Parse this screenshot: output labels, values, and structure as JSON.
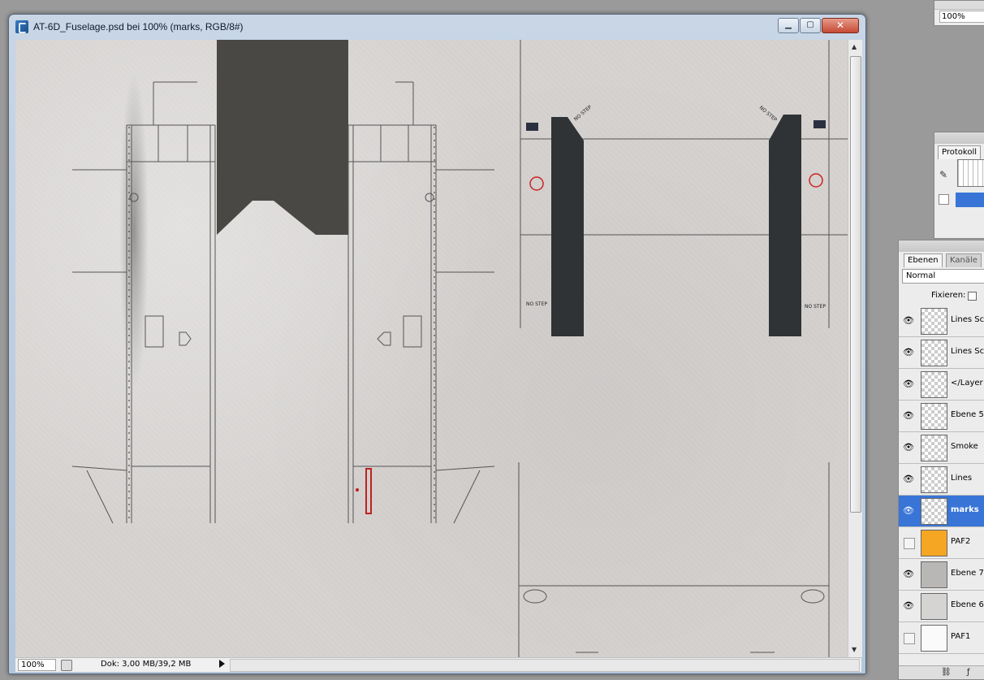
{
  "document": {
    "title": "AT-6D_Fuselage.psd bei 100% (marks, RGB/8#)",
    "minimize_label": "▁",
    "maximize_label": "▢",
    "close_label": "✕"
  },
  "status": {
    "zoom": "100%",
    "doc_size": "Dok: 3,00 MB/39,2 MB"
  },
  "navigator": {
    "zoom": "100%"
  },
  "history": {
    "tab": "Protokoll"
  },
  "layers": {
    "tab_layers": "Ebenen",
    "tab_channels": "Kanäle",
    "blend_mode": "Normal",
    "lock_label": "Fixieren:",
    "items": [
      {
        "name": "Lines Sch",
        "visible": true,
        "thumb": "transparent"
      },
      {
        "name": "Lines Sch",
        "visible": true,
        "thumb": "transparent"
      },
      {
        "name": "</Layer s",
        "visible": true,
        "thumb": "transparent"
      },
      {
        "name": "Ebene 5",
        "visible": true,
        "thumb": "transparent"
      },
      {
        "name": "Smoke",
        "visible": true,
        "thumb": "transparent"
      },
      {
        "name": "Lines",
        "visible": true,
        "thumb": "transparent"
      },
      {
        "name": "marks",
        "visible": true,
        "thumb": "transparent",
        "selected": true
      },
      {
        "name": "PAF2",
        "visible": false,
        "thumb": "orange"
      },
      {
        "name": "Ebene 7",
        "visible": true,
        "thumb": "gray"
      },
      {
        "name": "Ebene 6",
        "visible": true,
        "thumb": "light"
      },
      {
        "name": "PAF1",
        "visible": false,
        "thumb": "white"
      }
    ]
  },
  "canvas_text": {
    "no_step": "NO STEP"
  },
  "colors": {
    "selection": "#3875d7",
    "walkway": "#2f3336",
    "canvas": "#d6d3d1"
  }
}
